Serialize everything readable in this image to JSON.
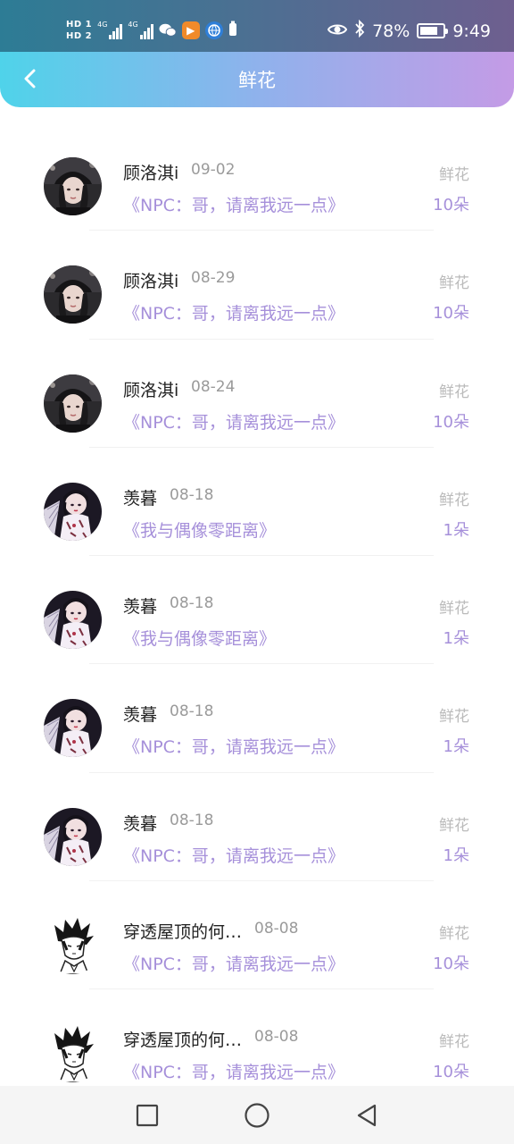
{
  "status_bar": {
    "hd1": "HD 1",
    "hd2": "HD 2",
    "net1": "4G",
    "net2": "4G",
    "battery_pct": "78%",
    "battery_level": 0.78,
    "time": "9:49"
  },
  "header": {
    "title": "鲜花",
    "back_icon": "back-arrow-icon"
  },
  "records": [
    {
      "name": "顾洛淇i",
      "date": "09-02",
      "book": "《NPC：哥，请离我远一点》",
      "gift": "鲜花",
      "count": "10朵",
      "avatar": "girl-cap"
    },
    {
      "name": "顾洛淇i",
      "date": "08-29",
      "book": "《NPC：哥，请离我远一点》",
      "gift": "鲜花",
      "count": "10朵",
      "avatar": "girl-cap"
    },
    {
      "name": "顾洛淇i",
      "date": "08-24",
      "book": "《NPC：哥，请离我远一点》",
      "gift": "鲜花",
      "count": "10朵",
      "avatar": "girl-cap"
    },
    {
      "name": "羡暮",
      "date": "08-18",
      "book": "《我与偶像零距离》",
      "gift": "鲜花",
      "count": "1朵",
      "avatar": "anime-girl-fan"
    },
    {
      "name": "羡暮",
      "date": "08-18",
      "book": "《我与偶像零距离》",
      "gift": "鲜花",
      "count": "1朵",
      "avatar": "anime-girl-fan"
    },
    {
      "name": "羡暮",
      "date": "08-18",
      "book": "《NPC：哥，请离我远一点》",
      "gift": "鲜花",
      "count": "1朵",
      "avatar": "anime-girl-fan"
    },
    {
      "name": "羡暮",
      "date": "08-18",
      "book": "《NPC：哥，请离我远一点》",
      "gift": "鲜花",
      "count": "1朵",
      "avatar": "anime-girl-fan"
    },
    {
      "name": "穿透屋顶的何…",
      "date": "08-08",
      "book": "《NPC：哥，请离我远一点》",
      "gift": "鲜花",
      "count": "10朵",
      "avatar": "manga-boy-sketch"
    },
    {
      "name": "穿透屋顶的何…",
      "date": "08-08",
      "book": "《NPC：哥，请离我远一点》",
      "gift": "鲜花",
      "count": "10朵",
      "avatar": "manga-boy-sketch"
    }
  ],
  "bottom_nav": {
    "recents": "square-icon",
    "home": "circle-icon",
    "back": "triangle-back-icon"
  },
  "colors": {
    "header_start": "#4fd3ea",
    "header_end": "#c49be6",
    "accent": "#a690da",
    "name": "#222222",
    "date": "#9a9a9a",
    "gift": "#bbbbbb"
  }
}
